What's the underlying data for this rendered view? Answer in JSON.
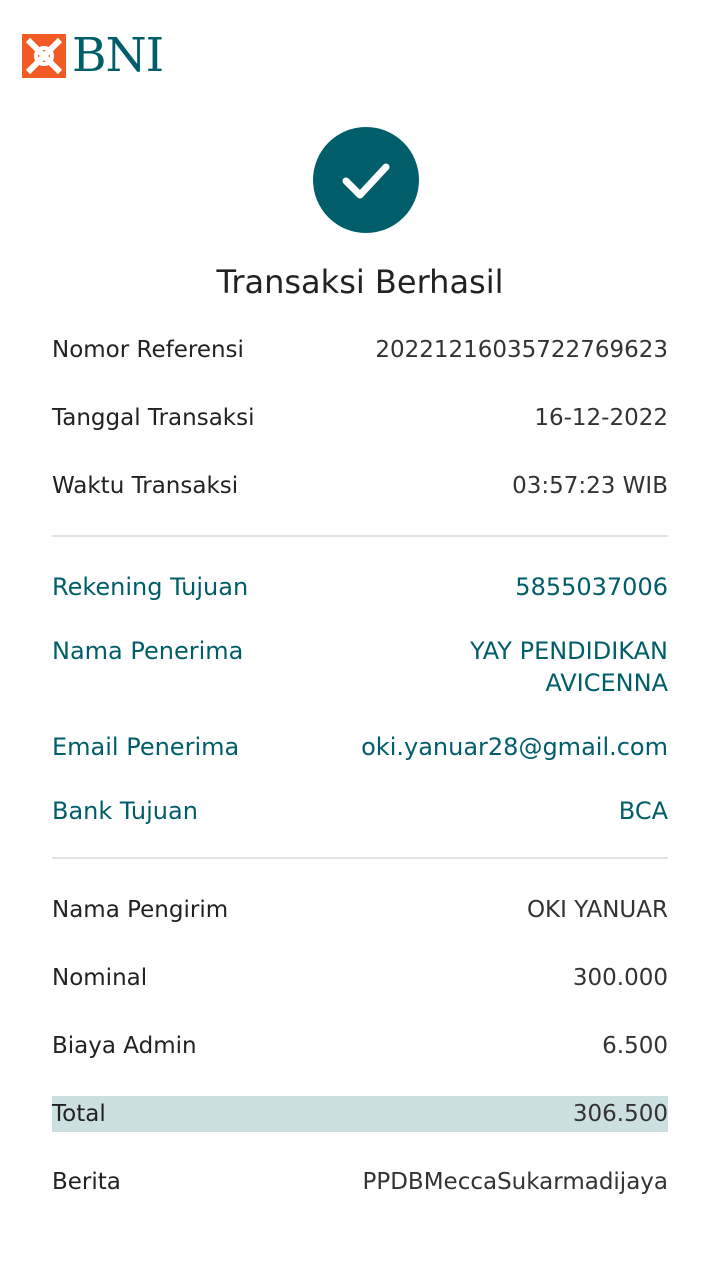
{
  "colors": {
    "brand_teal": "#005e6a",
    "brand_orange": "#f15a22",
    "total_highlight": "#cde0e1",
    "divider": "#e2e2e2"
  },
  "header": {
    "logo_text": "BNI"
  },
  "status": {
    "icon": "check-icon",
    "title": "Transaksi Berhasil"
  },
  "transaction": {
    "reference": {
      "label": "Nomor Referensi",
      "value": "20221216035722769623"
    },
    "date": {
      "label": "Tanggal Transaksi",
      "value": "16-12-2022"
    },
    "time": {
      "label": "Waktu Transaksi",
      "value": "03:57:23 WIB"
    }
  },
  "recipient": {
    "account": {
      "label": "Rekening Tujuan",
      "value": "5855037006"
    },
    "name": {
      "label": "Nama Penerima",
      "value": "YAY PENDIDIKAN AVICENNA"
    },
    "email": {
      "label": "Email Penerima",
      "value": "oki.yanuar28@gmail.com"
    },
    "bank": {
      "label": "Bank Tujuan",
      "value": "BCA"
    }
  },
  "payment": {
    "sender": {
      "label": "Nama Pengirim",
      "value": "OKI YANUAR"
    },
    "amount": {
      "label": "Nominal",
      "value": "300.000"
    },
    "fee": {
      "label": "Biaya Admin",
      "value": "6.500"
    },
    "total": {
      "label": "Total",
      "value": "306.500"
    },
    "note": {
      "label": "Berita",
      "value": "PPDBMeccaSukarmadijaya"
    }
  }
}
